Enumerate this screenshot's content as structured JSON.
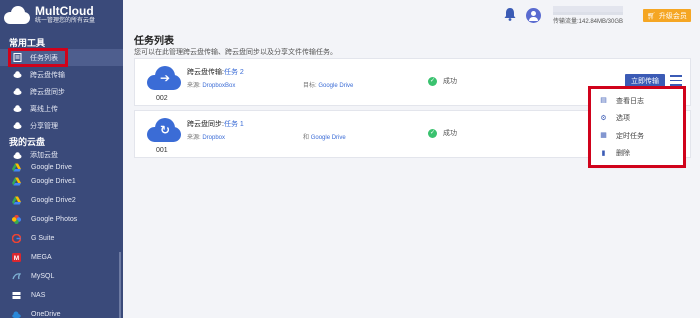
{
  "brand": {
    "name": "MultCloud",
    "tagline": "统一管理您的所有云盘"
  },
  "sidebar": {
    "section_tools": "常用工具",
    "tools": [
      {
        "label": "任务列表",
        "icon": "task-list-icon"
      },
      {
        "label": "跨云盘传输",
        "icon": "cloud-transfer-icon"
      },
      {
        "label": "跨云盘同步",
        "icon": "cloud-sync-icon"
      },
      {
        "label": "离线上传",
        "icon": "offline-upload-icon"
      },
      {
        "label": "分享管理",
        "icon": "share-icon"
      }
    ],
    "section_clouds": "我的云盘",
    "add_cloud": "添加云盘",
    "clouds": [
      {
        "label": "Google Drive",
        "icon": "google-drive-icon"
      },
      {
        "label": "Google Drive1",
        "icon": "google-drive-icon"
      },
      {
        "label": "Google Drive2",
        "icon": "google-drive-icon"
      },
      {
        "label": "Google Photos",
        "icon": "google-photos-icon"
      },
      {
        "label": "G Suite",
        "icon": "g-suite-icon"
      },
      {
        "label": "MEGA",
        "icon": "mega-icon"
      },
      {
        "label": "MySQL",
        "icon": "mysql-icon"
      },
      {
        "label": "NAS",
        "icon": "nas-icon"
      },
      {
        "label": "OneDrive",
        "icon": "onedrive-icon"
      }
    ]
  },
  "header": {
    "traffic": "传输流量:142.84MB/30GB",
    "upgrade": "升级会员"
  },
  "main": {
    "title": "任务列表",
    "subtitle": "您可以在此管理跨云盘传输、跨云盘同步以及分享文件传输任务。"
  },
  "tasks": [
    {
      "type_label": "跨云盘传输:",
      "task_name": "任务 2",
      "number": "002",
      "source_label": "来源:",
      "source": "DropboxBox",
      "target_label": "目标:",
      "target": "Google Drive",
      "status": "成功",
      "action": "立即传输"
    },
    {
      "type_label": "跨云盘同步:",
      "task_name": "任务 1",
      "number": "001",
      "source_label": "来源:",
      "source": "Dropbox",
      "target_label": "和",
      "target": "Google Drive",
      "status": "成功"
    }
  ],
  "dropdown": [
    {
      "label": "查看日志",
      "icon": "log-icon"
    },
    {
      "label": "选项",
      "icon": "options-icon"
    },
    {
      "label": "定时任务",
      "icon": "schedule-icon"
    },
    {
      "label": "删除",
      "icon": "delete-icon"
    }
  ],
  "colors": {
    "sidebar": "#3a4a7a",
    "accent": "#3b6cd6",
    "button": "#3b5bb5",
    "upgrade": "#f5a623",
    "success": "#3ac26f",
    "highlight": "#d0021b"
  }
}
